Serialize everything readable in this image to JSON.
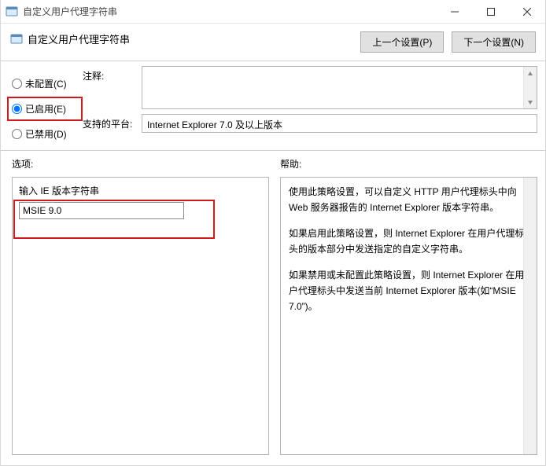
{
  "window": {
    "title": "自定义用户代理字符串"
  },
  "header": {
    "title": "自定义用户代理字符串",
    "prev_btn": "上一个设置(P)",
    "next_btn": "下一个设置(N)"
  },
  "state": {
    "not_configured": "未配置(C)",
    "enabled": "已启用(E)",
    "disabled": "已禁用(D)",
    "selected": "enabled"
  },
  "fields": {
    "comment_label": "注释:",
    "comment_value": "",
    "platform_label": "支持的平台:",
    "platform_value": "Internet Explorer 7.0 及以上版本"
  },
  "options": {
    "section_label": "选项:",
    "input_label": "输入 IE 版本字符串",
    "input_value": "MSIE 9.0"
  },
  "help": {
    "section_label": "帮助:",
    "p1": "使用此策略设置，可以自定义 HTTP 用户代理标头中向 Web 服务器报告的 Internet Explorer 版本字符串。",
    "p2": "如果启用此策略设置，则 Internet Explorer 在用户代理标头的版本部分中发送指定的自定义字符串。",
    "p3": "如果禁用或未配置此策略设置，则 Internet Explorer 在用户代理标头中发送当前 Internet Explorer 版本(如“MSIE 7.0”)。"
  }
}
